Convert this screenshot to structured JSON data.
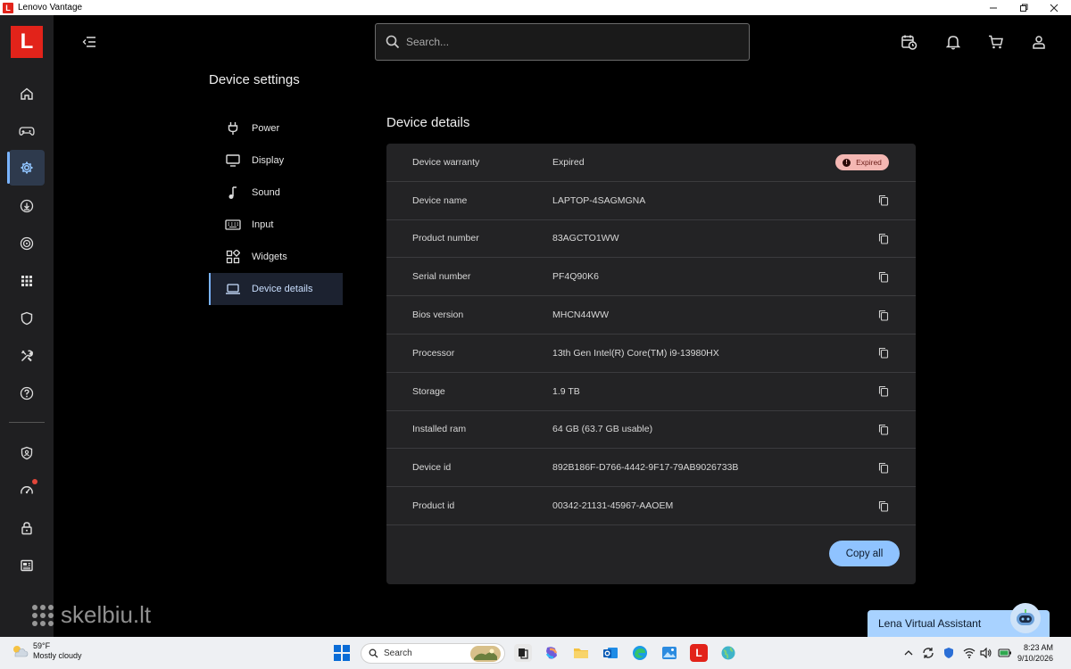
{
  "window": {
    "app_title": "Lenovo Vantage",
    "badge": "L"
  },
  "rail": {
    "logo": "L"
  },
  "search": {
    "placeholder": "Search..."
  },
  "page": {
    "title": "Device settings"
  },
  "subnav": {
    "items": [
      {
        "label": "Power",
        "icon": "plug-icon"
      },
      {
        "label": "Display",
        "icon": "monitor-icon"
      },
      {
        "label": "Sound",
        "icon": "music-note-icon"
      },
      {
        "label": "Input",
        "icon": "keyboard-icon"
      },
      {
        "label": "Widgets",
        "icon": "widgets-icon"
      },
      {
        "label": "Device details",
        "icon": "laptop-icon"
      }
    ]
  },
  "details": {
    "title": "Device details",
    "rows": [
      {
        "key": "Device warranty",
        "value": "Expired"
      },
      {
        "key": "Device name",
        "value": "LAPTOP-4SAGMGNA"
      },
      {
        "key": "Product number",
        "value": "83AGCTO1WW"
      },
      {
        "key": "Serial number",
        "value": "PF4Q90K6"
      },
      {
        "key": "Bios version",
        "value": "MHCN44WW"
      },
      {
        "key": "Processor",
        "value": "13th Gen Intel(R) Core(TM) i9-13980HX"
      },
      {
        "key": "Storage",
        "value": "1.9 TB"
      },
      {
        "key": "Installed ram",
        "value": "64 GB (63.7 GB usable)"
      },
      {
        "key": "Device id",
        "value": "892B186F-D766-4442-9F17-79AB9026733B"
      },
      {
        "key": "Product id",
        "value": "00342-21131-45967-AAOEM"
      }
    ],
    "warranty_badge": "Expired",
    "badge_glyph": "!",
    "copy_all_label": "Copy all"
  },
  "watermark": {
    "text": "skelbiu.lt"
  },
  "assistant": {
    "label": "Lena Virtual Assistant"
  },
  "taskbar": {
    "weather_temp": "59°F",
    "weather_desc": "Mostly cloudy",
    "search_label": "Search",
    "time": "8:23 AM",
    "date": "9/10/2026"
  },
  "colors": {
    "accent": "#8fc3ff",
    "brand": "#e2231a",
    "badge_bg": "#f4b7b3"
  }
}
